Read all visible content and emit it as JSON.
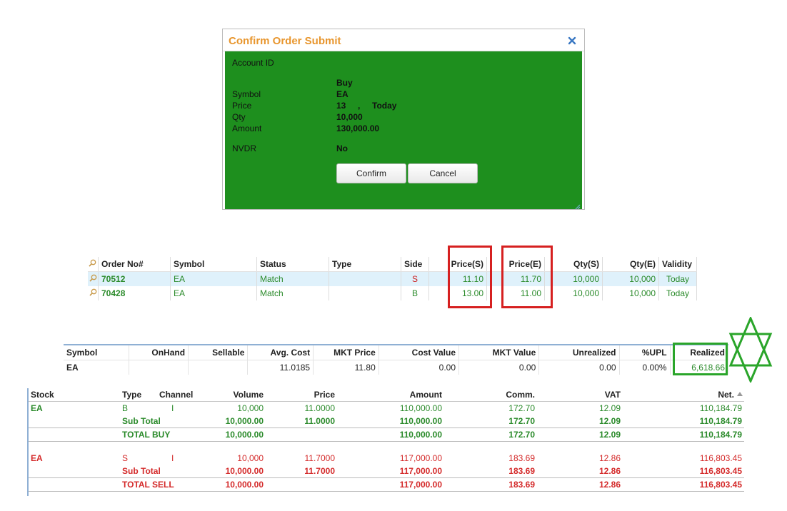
{
  "modal": {
    "title": "Confirm Order Submit",
    "labels": {
      "account": "Account ID",
      "symbol": "Symbol",
      "price": "Price",
      "qty": "Qty",
      "amount": "Amount",
      "nvdr": "NVDR"
    },
    "values": {
      "side": "Buy",
      "symbol": "EA",
      "price": "13",
      "price_sep": ",",
      "price_validity": "Today",
      "qty": "10,000",
      "amount": "130,000.00",
      "nvdr": "No"
    },
    "confirm_label": "Confirm",
    "cancel_label": "Cancel",
    "background_color": "#1e8f1e",
    "title_color": "#e8962e"
  },
  "orders": {
    "headers": [
      "Order No#",
      "Symbol",
      "Status",
      "Type",
      "Side",
      "Price(S)",
      "Price(E)",
      "Qty(S)",
      "Qty(E)",
      "Validity"
    ],
    "rows": [
      {
        "order_no": "70512",
        "symbol": "EA",
        "status": "Match",
        "type": "",
        "side": "S",
        "price_s": "11.10",
        "price_e": "11.70",
        "qty_s": "10,000",
        "qty_e": "10,000",
        "validity": "Today"
      },
      {
        "order_no": "70428",
        "symbol": "EA",
        "status": "Match",
        "type": "",
        "side": "B",
        "price_s": "13.00",
        "price_e": "11.00",
        "qty_s": "10,000",
        "qty_e": "10,000",
        "validity": "Today"
      }
    ]
  },
  "portfolio": {
    "headers": [
      "Symbol",
      "OnHand",
      "Sellable",
      "Avg. Cost",
      "MKT Price",
      "Cost Value",
      "MKT Value",
      "Unrealized",
      "%UPL",
      "Realized"
    ],
    "row": {
      "symbol": "EA",
      "onhand": "",
      "sellable": "",
      "avg_cost": "11.0185",
      "mkt_price": "11.80",
      "cost_value": "0.00",
      "mkt_value": "0.00",
      "unrealized": "0.00",
      "upl": "0.00%",
      "realized": "6,618.66"
    }
  },
  "summary": {
    "headers": {
      "stock": "Stock",
      "type": "Type",
      "channel": "Channel",
      "volume": "Volume",
      "price": "Price",
      "amount": "Amount",
      "comm": "Comm.",
      "vat": "VAT",
      "net": "Net."
    },
    "buy": {
      "stock": "EA",
      "type": "B",
      "channel": "I",
      "volume": "10,000",
      "price": "11.0000",
      "amount": "110,000.00",
      "comm": "172.70",
      "vat": "12.09",
      "net": "110,184.79",
      "subtotal_label": "Sub Total",
      "sub_volume": "10,000.00",
      "sub_price": "11.0000",
      "sub_amount": "110,000.00",
      "sub_comm": "172.70",
      "sub_vat": "12.09",
      "sub_net": "110,184.79",
      "total_label": "TOTAL BUY",
      "tot_volume": "10,000.00",
      "tot_amount": "110,000.00",
      "tot_comm": "172.70",
      "tot_vat": "12.09",
      "tot_net": "110,184.79"
    },
    "sell": {
      "stock": "EA",
      "type": "S",
      "channel": "I",
      "volume": "10,000",
      "price": "11.7000",
      "amount": "117,000.00",
      "comm": "183.69",
      "vat": "12.86",
      "net": "116,803.45",
      "subtotal_label": "Sub Total",
      "sub_volume": "10,000.00",
      "sub_price": "11.7000",
      "sub_amount": "117,000.00",
      "sub_comm": "183.69",
      "sub_vat": "12.86",
      "sub_net": "116,803.45",
      "total_label": "TOTAL SELL",
      "tot_volume": "10,000.00",
      "tot_amount": "117,000.00",
      "tot_comm": "183.69",
      "tot_vat": "12.86",
      "tot_net": "116,803.45"
    }
  },
  "colors": {
    "buy": "#2a8a2a",
    "sell": "#d42a2a",
    "highlight_red": "#d62020",
    "highlight_green": "#2aa52a"
  }
}
